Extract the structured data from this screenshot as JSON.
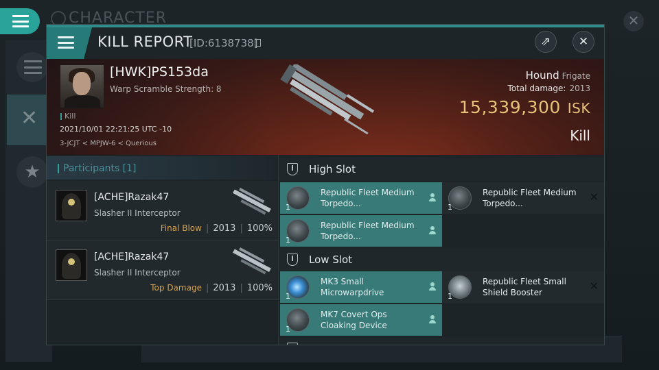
{
  "background": {
    "title": "CHARACTER",
    "close_glyph": "✕",
    "rail_icons": [
      "menu-icon",
      "crossed-swords-icon",
      "star-icon"
    ]
  },
  "dialog": {
    "title": "KILL REPORT",
    "id_text": "[ID:6138738]",
    "share_glyph": "⇗",
    "close_glyph": "✕",
    "accent_color": "#2f8d89"
  },
  "victim": {
    "name": "[HWK]PS153da",
    "warp_scramble": "Warp Scramble Strength: 8",
    "tag": "Kill",
    "datetime": "2021/10/01 22:21:25 UTC -10",
    "location": "3-JCJT < MPJW-6 < Querious",
    "ship": "Hound",
    "ship_class": "Frigate",
    "total_damage_label": "Total damage:",
    "total_damage": "2013",
    "isk_value": "15,339,300",
    "isk_unit": "ISK",
    "result": "Kill",
    "isk_color": "#e8c27a"
  },
  "participants": {
    "header": "Participants [1]",
    "rows": [
      {
        "name": "[ACHE]Razak47",
        "ship": "Slasher II Interceptor",
        "tag": "Final Blow",
        "damage": "2013",
        "percent": "100%"
      },
      {
        "name": "[ACHE]Razak47",
        "ship": "Slasher II Interceptor",
        "tag": "Top Damage",
        "damage": "2013",
        "percent": "100%"
      }
    ]
  },
  "slots": {
    "high": {
      "label": "High Slot",
      "modules": [
        {
          "name": "Republic Fleet Medium Torpedo...",
          "qty": "1",
          "state": "dropped"
        },
        {
          "name": "Republic Fleet Medium Torpedo...",
          "qty": "1",
          "state": "destroyed"
        },
        {
          "name": "Republic Fleet Medium Torpedo...",
          "qty": "1",
          "state": "dropped"
        }
      ]
    },
    "low": {
      "label": "Low Slot",
      "modules": [
        {
          "name": "MK3 Small Microwarpdrive",
          "qty": "1",
          "state": "dropped"
        },
        {
          "name": "Republic Fleet Small Shield Booster",
          "qty": "1",
          "state": "destroyed"
        },
        {
          "name": "MK7 Covert Ops Cloaking Device",
          "qty": "1",
          "state": "dropped"
        }
      ]
    },
    "destroyed_glyph": "✕"
  }
}
